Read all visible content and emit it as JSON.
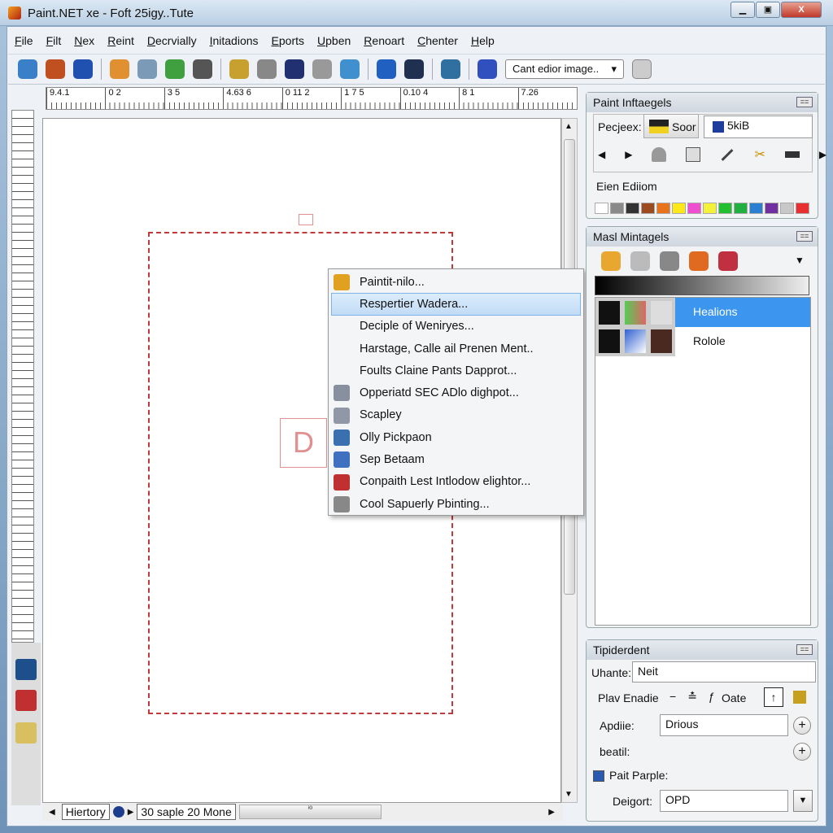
{
  "window": {
    "title": "Paint.NET xe - Foft 25igy..Tute",
    "minimize": "▁",
    "maximize": "▣",
    "close": "X"
  },
  "menu": [
    "File",
    "Filt",
    "Nex",
    "Reint",
    "Decrvially",
    "Initadions",
    "Eports",
    "Upben",
    "Renoart",
    "Chenter",
    "Help"
  ],
  "toolbar": {
    "zoom_select": "Cant edior image..",
    "dropdown_arrow": "▾",
    "icons": [
      {
        "name": "brush",
        "color": "#3a80c8"
      },
      {
        "name": "pencil",
        "color": "#c05020"
      },
      {
        "name": "sphere",
        "color": "#2050b0"
      },
      {
        "name": "person",
        "color": "#e09030"
      },
      {
        "name": "spray",
        "color": "#7a9ab8"
      },
      {
        "name": "bucket",
        "color": "#40a040"
      },
      {
        "name": "layers",
        "color": "#555"
      },
      {
        "name": "magnifier",
        "color": "#c8a030"
      },
      {
        "name": "wrench",
        "color": "#888"
      },
      {
        "name": "film",
        "color": "#203070"
      },
      {
        "name": "tools",
        "color": "#999"
      },
      {
        "name": "pen",
        "color": "#4090d0"
      },
      {
        "name": "disc",
        "color": "#2060c0"
      },
      {
        "name": "portrait",
        "color": "#203050"
      },
      {
        "name": "chart",
        "color": "#3070a0"
      },
      {
        "name": "monitor",
        "color": "#3050c0"
      }
    ]
  },
  "ruler": {
    "labels": [
      "9.4.1",
      "0 2",
      "3 5",
      "4.63 6",
      "0 11 2",
      "1 7 5",
      "0.10 4",
      "8 1",
      "7.26"
    ]
  },
  "canvas": {
    "shape_letter": "D"
  },
  "context_menu": {
    "selected_index": 1,
    "items": [
      {
        "label": "Paintit-nilo...",
        "icon": "paint-icon",
        "color": "#e0a020"
      },
      {
        "label": "Respertier Wadera...",
        "icon": "",
        "color": ""
      },
      {
        "label": "Deciple of Weniryes...",
        "icon": "",
        "color": ""
      },
      {
        "label": "Harstage, Calle ail Prenen Ment..",
        "icon": "",
        "color": ""
      },
      {
        "label": "Foults Claine Pants Dapprot...",
        "icon": "",
        "color": ""
      },
      {
        "label": "Opperiatd SEC ADlo dighpot...",
        "icon": "grid-icon",
        "color": "#8890a0"
      },
      {
        "label": "Scapley",
        "icon": "envelope-icon",
        "color": "#9098a8"
      },
      {
        "label": "Olly Pickpaon",
        "icon": "window-icon",
        "color": "#3a70b0"
      },
      {
        "label": "Sep Betaam",
        "icon": "mouse-icon",
        "color": "#4070c0"
      },
      {
        "label": "Conpaith Lest Intlodow elightor...",
        "icon": "picture-icon",
        "color": "#c03030"
      },
      {
        "label": "Cool Sapuerly Pbinting...",
        "icon": "tool-icon",
        "color": "#888"
      }
    ]
  },
  "bottom_bar": {
    "left_arrow": "◀",
    "tab": "Hiertory",
    "right_arrow": "▶",
    "status": "30 saple 20 Mone",
    "thumb_label": "ⁱ⁰",
    "end_arrow": "▶"
  },
  "panel1": {
    "title": "Paint Inftaegels",
    "label": "Pecjeex:",
    "button": "Soor",
    "field": "5kiB",
    "section": "Eien Ediiom",
    "palette": [
      "#ffffff",
      "#8a8a8a",
      "#333333",
      "#9c4a20",
      "#e8731a",
      "#ffe81a",
      "#f050d0",
      "#f5f03a",
      "#22c030",
      "#20b040",
      "#2a7fd0",
      "#7030a0",
      "#c8c8c8",
      "#e83030"
    ]
  },
  "panel2": {
    "title": "Masl Mintagels",
    "layers": [
      {
        "label": "Healions",
        "selected": true
      },
      {
        "label": "Rolole",
        "selected": false
      }
    ]
  },
  "panel3": {
    "title": "Tipiderdent",
    "uhante_label": "Uhante:",
    "uhante_value": "Neit",
    "play_label": "Plav Enadie",
    "oate_label": "Oate",
    "apdie_label": "Apdiie:",
    "apdie_value": "Drious",
    "beatil_label": "beatil:",
    "paint_label": "Pait Parple:",
    "deigon_label": "Deigort:",
    "deigon_value": "OPD",
    "plus": "+",
    "up_arrow": "↑"
  }
}
